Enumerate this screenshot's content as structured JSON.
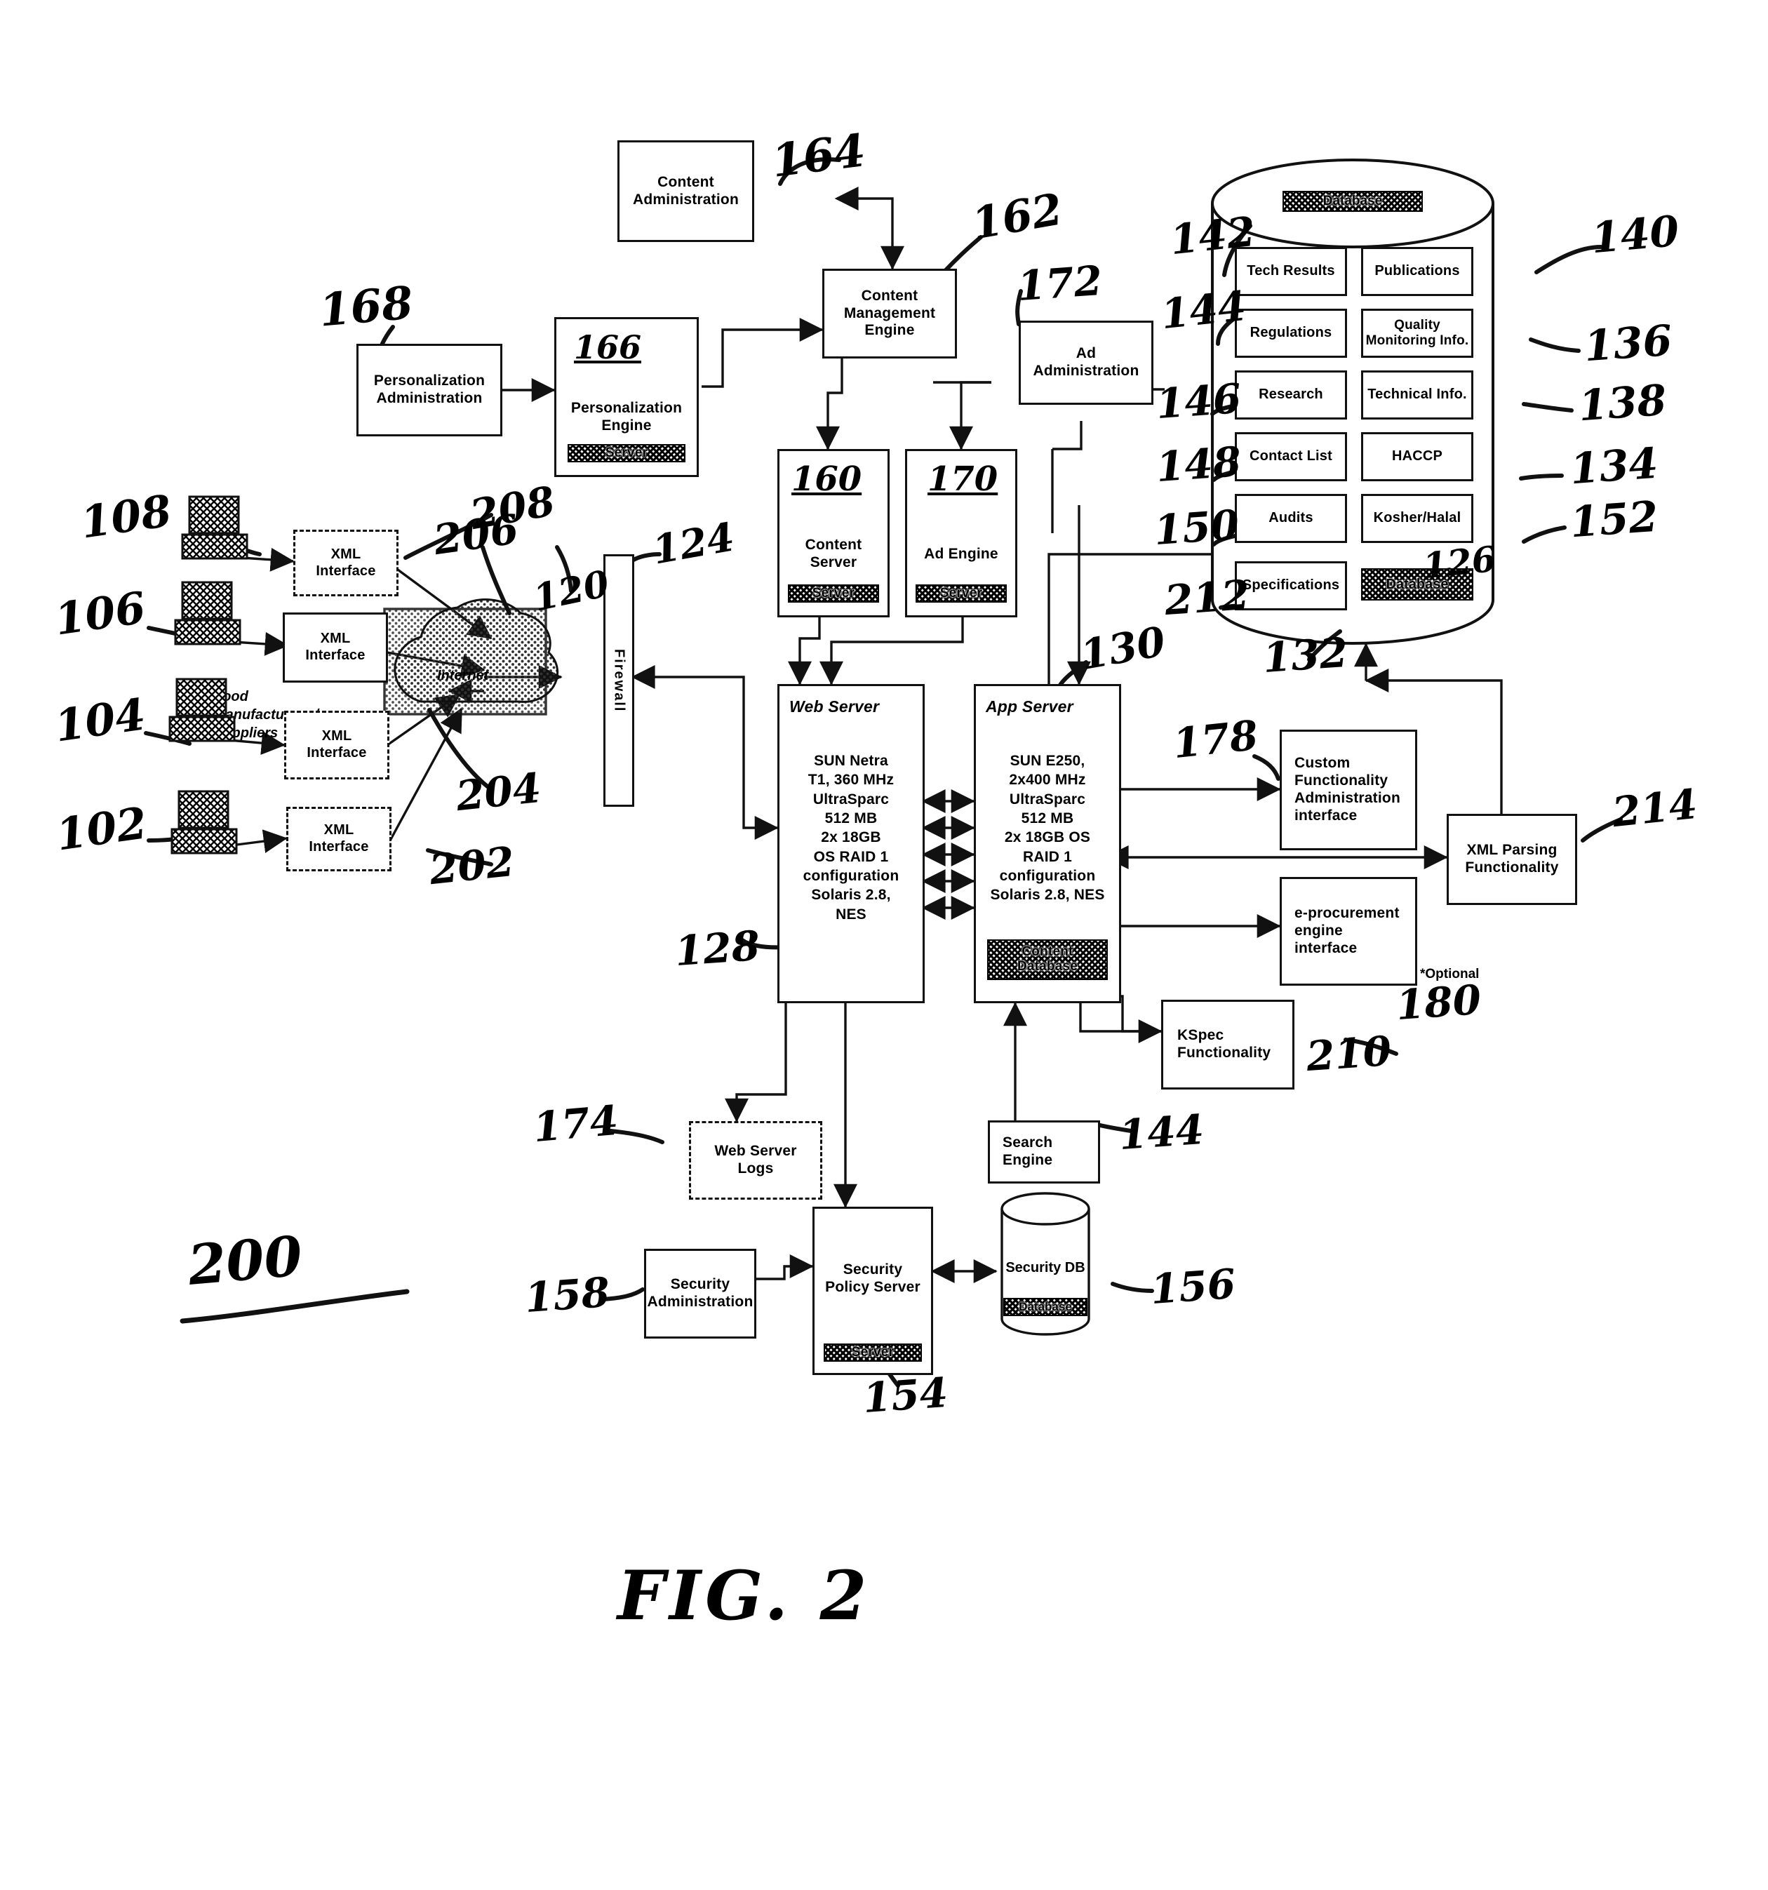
{
  "figure": {
    "caption": "FIG. 2",
    "system_ref": "200"
  },
  "nodes": {
    "content_administration": {
      "lines": "Content\nAdministration",
      "ref": "164"
    },
    "content_management_engine": {
      "lines": "Content\nManagement\nEngine",
      "ref": "162"
    },
    "personalization_administration": {
      "lines": "Personalization\nAdministration",
      "ref": "168"
    },
    "personalization_engine": {
      "lines": "Personalization\nEngine",
      "ref": "166",
      "hatch": "Server"
    },
    "ad_administration": {
      "lines": "Ad\nAdministration",
      "ref": "172"
    },
    "content_server": {
      "lines": "Content\nServer",
      "ref": "160",
      "hatch": "Server"
    },
    "ad_engine": {
      "lines": "Ad Engine",
      "ref": "170",
      "hatch": "Server"
    },
    "web_server": {
      "title": "Web Server",
      "spec": "SUN Netra\nT1, 360 MHz\nUltraSparc\n512 MB\n2x 18GB\nOS RAID 1\nconfiguration\nSolaris 2.8,\nNES",
      "ref": "128"
    },
    "app_server": {
      "title": "App Server",
      "spec": "SUN E250,\n2x400 MHz\nUltraSparc\n512 MB\n2x 18GB OS\nRAID 1\nconfiguration\nSolaris 2.8, NES",
      "ref": "130",
      "hatch": "Content\nDatabase"
    },
    "firewall": {
      "label": "Firewall",
      "ref": "124"
    },
    "internet": {
      "label": "Internet",
      "ref": "120"
    },
    "custom_functionality_admin": {
      "lines": "Custom\nFunctionality\nAdministration\ninterface",
      "ref": "178"
    },
    "eprocurement_engine_interface": {
      "lines": "e-procurement\nengine\ninterface",
      "ref": "180",
      "note": "*Optional"
    },
    "xml_parsing_functionality": {
      "lines": "XML Parsing\nFunctionality",
      "ref": "214"
    },
    "kspec_functionality": {
      "lines": "KSpec\nFunctionality",
      "ref": "210"
    },
    "web_server_logs": {
      "lines": "Web Server\nLogs",
      "ref": "174"
    },
    "search_engine": {
      "lines": "Search\nEngine",
      "ref": "144"
    },
    "security_administration": {
      "lines": "Security\nAdministration",
      "ref": "158"
    },
    "security_policy_server": {
      "lines": "Security\nPolicy Server",
      "ref": "154",
      "hatch": "Server"
    },
    "security_db": {
      "label": "Security DB",
      "ref": "156",
      "hatch": "Database"
    }
  },
  "database": {
    "ref_body": "132",
    "ref_top_hatch": "Database",
    "ref_bottom_hatch": "Database",
    "ref_bottom_hatch_num": "126",
    "left_column": [
      {
        "label": "Tech Results",
        "ref": "142"
      },
      {
        "label": "Regulations",
        "ref": "144"
      },
      {
        "label": "Research",
        "ref": "146"
      },
      {
        "label": "Contact List",
        "ref": "148"
      },
      {
        "label": "Audits",
        "ref": "150"
      },
      {
        "label": "Specifications",
        "ref": "212"
      }
    ],
    "right_column": [
      {
        "label": "Publications",
        "ref": "140"
      },
      {
        "label": "Quality\nMonitoring Info.",
        "ref": "136"
      },
      {
        "label": "Technical Info.",
        "ref": "138"
      },
      {
        "label": "HACCP",
        "ref": "134"
      },
      {
        "label": "Kosher/Halal",
        "ref": "152"
      }
    ]
  },
  "clients": {
    "group_label": "Food\nManufacturers /\nSuppliers",
    "items": [
      {
        "pc_ref": "108",
        "xml_label": "XML\nInterface",
        "xml_ref": "208",
        "dashed": true
      },
      {
        "pc_ref": "106",
        "xml_label": "XML\nInterface",
        "xml_ref": "206",
        "dashed": false
      },
      {
        "pc_ref": "104",
        "xml_label": "XML\nInterface",
        "xml_ref": "204",
        "dashed": true
      },
      {
        "pc_ref": "102",
        "xml_label": "XML\nInterface",
        "xml_ref": "202",
        "dashed": true
      }
    ]
  }
}
